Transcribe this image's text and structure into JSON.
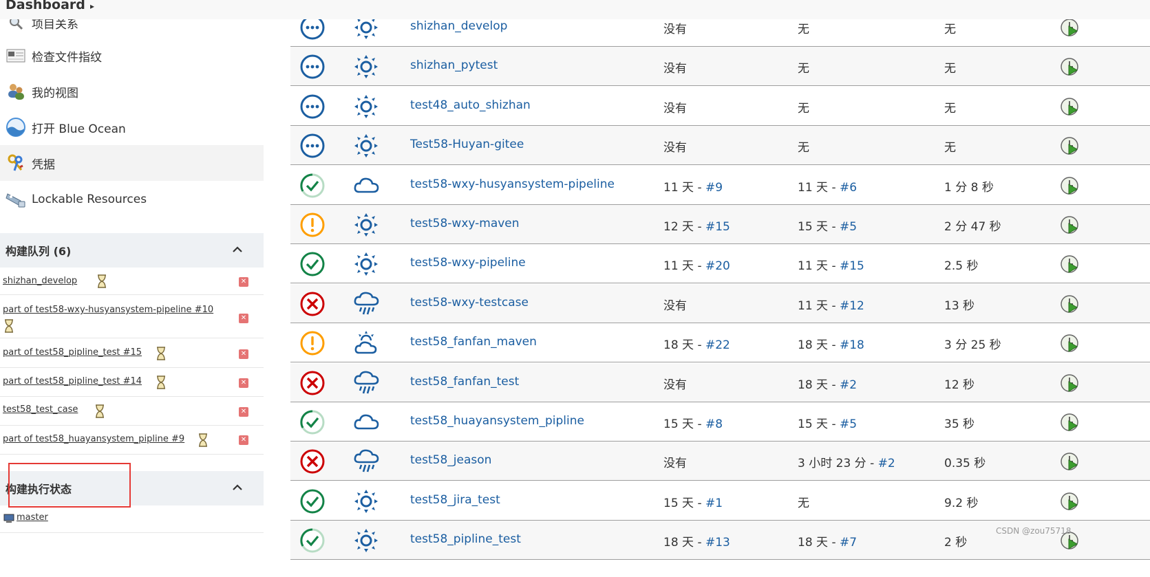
{
  "breadcrumb": {
    "root": "Dashboard"
  },
  "sidebar": {
    "items": [
      {
        "label": "项目关系",
        "icon": "search-icon"
      },
      {
        "label": "检查文件指纹",
        "icon": "fingerprint-icon"
      },
      {
        "label": "我的视图",
        "icon": "users-icon"
      },
      {
        "label": "打开 Blue Ocean",
        "icon": "blue-ocean-icon"
      },
      {
        "label": "凭据",
        "icon": "keys-icon"
      },
      {
        "label": "Lockable Resources",
        "icon": "lock-resource-icon"
      }
    ]
  },
  "build_queue": {
    "title": "构建队列 (6)",
    "items": [
      "shizhan_develop",
      "part of test58-wxy-husyansystem-pipeline #10",
      "part of test58_pipline_test #15",
      "part of test58_pipline_test #14",
      "test58_test_case",
      "part of test58_huayansystem_pipline #9"
    ]
  },
  "executor": {
    "title": "构建执行状态",
    "nodes": [
      "master"
    ]
  },
  "jobs": [
    {
      "status": "notbuilt",
      "weather": "sunny",
      "name": "shizhan_develop",
      "last_success": "没有",
      "last_success_num": "",
      "last_failure": "无",
      "last_failure_num": "",
      "duration": "无"
    },
    {
      "status": "notbuilt",
      "weather": "sunny",
      "name": "shizhan_pytest",
      "last_success": "没有",
      "last_success_num": "",
      "last_failure": "无",
      "last_failure_num": "",
      "duration": "无"
    },
    {
      "status": "notbuilt",
      "weather": "sunny",
      "name": "test48_auto_shizhan",
      "last_success": "没有",
      "last_success_num": "",
      "last_failure": "无",
      "last_failure_num": "",
      "duration": "无"
    },
    {
      "status": "notbuilt",
      "weather": "sunny",
      "name": "Test58-Huyan-gitee",
      "last_success": "没有",
      "last_success_num": "",
      "last_failure": "无",
      "last_failure_num": "",
      "duration": "无"
    },
    {
      "status": "success-running",
      "weather": "cloudy",
      "name": "test58-wxy-husyansystem-pipeline",
      "last_success": "11 天 - ",
      "last_success_num": "#9",
      "last_failure": "11 天 - ",
      "last_failure_num": "#6",
      "duration": "1 分 8 秒"
    },
    {
      "status": "unstable",
      "weather": "sunny",
      "name": "test58-wxy-maven",
      "last_success": "12 天 - ",
      "last_success_num": "#15",
      "last_failure": "15 天 - ",
      "last_failure_num": "#5",
      "duration": "2 分 47 秒"
    },
    {
      "status": "success",
      "weather": "sunny",
      "name": "test58-wxy-pipeline",
      "last_success": "11 天 - ",
      "last_success_num": "#20",
      "last_failure": "11 天 - ",
      "last_failure_num": "#15",
      "duration": "2.5 秒"
    },
    {
      "status": "failed",
      "weather": "rainy",
      "name": "test58-wxy-testcase",
      "last_success": "没有",
      "last_success_num": "",
      "last_failure": "11 天 - ",
      "last_failure_num": "#12",
      "duration": "13 秒"
    },
    {
      "status": "unstable",
      "weather": "partly-cloudy",
      "name": "test58_fanfan_maven",
      "last_success": "18 天 - ",
      "last_success_num": "#22",
      "last_failure": "18 天 - ",
      "last_failure_num": "#18",
      "duration": "3 分 25 秒"
    },
    {
      "status": "failed",
      "weather": "rainy",
      "name": "test58_fanfan_test",
      "last_success": "没有",
      "last_success_num": "",
      "last_failure": "18 天 - ",
      "last_failure_num": "#2",
      "duration": "12 秒"
    },
    {
      "status": "success-running",
      "weather": "cloudy",
      "name": "test58_huayansystem_pipline",
      "last_success": "15 天 - ",
      "last_success_num": "#8",
      "last_failure": "15 天 - ",
      "last_failure_num": "#5",
      "duration": "35 秒"
    },
    {
      "status": "failed",
      "weather": "rainy",
      "name": "test58_jeason",
      "last_success": "没有",
      "last_success_num": "",
      "last_failure": "3 小时 23 分 - ",
      "last_failure_num": "#2",
      "duration": "0.35 秒"
    },
    {
      "status": "success",
      "weather": "sunny",
      "name": "test58_jira_test",
      "last_success": "15 天 - ",
      "last_success_num": "#1",
      "last_failure": "无",
      "last_failure_num": "",
      "duration": "9.2 秒"
    },
    {
      "status": "success-running",
      "weather": "sunny",
      "name": "test58_pipline_test",
      "last_success": "18 天 - ",
      "last_success_num": "#13",
      "last_failure": "18 天 - ",
      "last_failure_num": "#7",
      "duration": "2 秒"
    }
  ],
  "colors": {
    "link": "#1b5ea1",
    "success": "#138347",
    "failed": "#cc0003",
    "unstable": "#fe9e00",
    "notbuilt": "#1b5ea1"
  },
  "watermark": "CSDN @zou75718"
}
